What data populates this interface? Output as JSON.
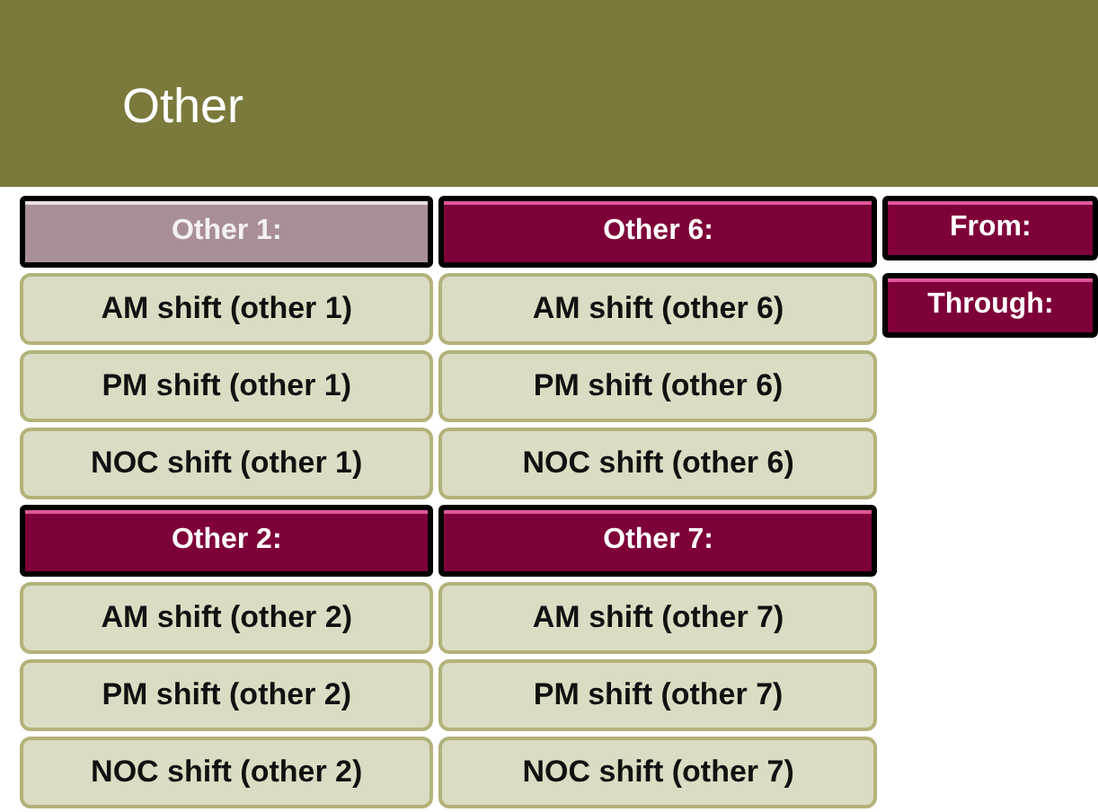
{
  "header": {
    "title": "Other"
  },
  "columns": [
    {
      "groups": [
        {
          "title": "Other 1:",
          "selected": true,
          "items": [
            "AM shift (other 1)",
            "PM shift (other 1)",
            "NOC shift (other 1)"
          ]
        },
        {
          "title": "Other 2:",
          "selected": false,
          "items": [
            "AM shift (other 2)",
            "PM shift (other 2)",
            "NOC shift (other 2)"
          ]
        }
      ]
    },
    {
      "groups": [
        {
          "title": "Other 6:",
          "selected": false,
          "items": [
            "AM shift (other 6)",
            "PM shift (other 6)",
            "NOC shift (other 6)"
          ]
        },
        {
          "title": "Other 7:",
          "selected": false,
          "items": [
            "AM shift (other 7)",
            "PM shift (other 7)",
            "NOC shift (other 7)"
          ]
        }
      ]
    }
  ],
  "range": [
    "From:",
    "Through:"
  ]
}
